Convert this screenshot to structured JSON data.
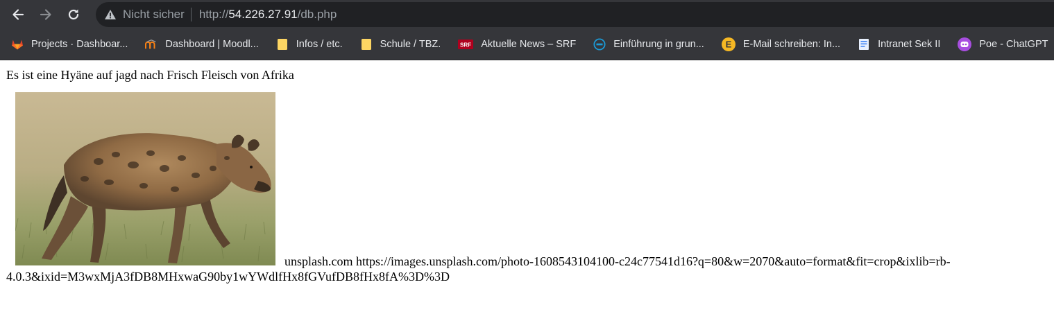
{
  "browser": {
    "security_label": "Nicht sicher",
    "url_scheme": "http://",
    "url_host": "54.226.27.91",
    "url_path": "/db.php"
  },
  "bookmarks": [
    {
      "label": "Projects · Dashboar...",
      "icon": "gitlab-icon"
    },
    {
      "label": "Dashboard | Moodl...",
      "icon": "moodle-icon"
    },
    {
      "label": "Infos / etc.",
      "icon": "folder-icon"
    },
    {
      "label": "Schule / TBZ.",
      "icon": "folder-icon"
    },
    {
      "label": "Aktuelle News – SRF",
      "icon": "srf-icon"
    },
    {
      "label": "Einführung in grun...",
      "icon": "dell-icon"
    },
    {
      "label": "E-Mail schreiben: In...",
      "icon": "e-icon"
    },
    {
      "label": "Intranet Sek II",
      "icon": "document-icon"
    },
    {
      "label": "Poe - ChatGPT",
      "icon": "poe-icon"
    }
  ],
  "page": {
    "heading": "Es ist eine Hyäne auf jagd nach Frisch Fleisch von Afrika",
    "image_subject": "hyena",
    "source_text": "unsplash.com https://images.unsplash.com/photo-1608543104100-c24c77541d16?q=80&w=2070&auto=format&fit=crop&ixlib=rb-4.0.3&ixid=M3wxMjA3fDB8MHxwaG90by1wYWdlfHx8fGVufDB8fHx8fA%3D%3D"
  },
  "colors": {
    "chrome_bg": "#35363a",
    "omnibox_bg": "#202124",
    "text_light": "#e8eaed",
    "text_dim": "#9aa0a6"
  }
}
